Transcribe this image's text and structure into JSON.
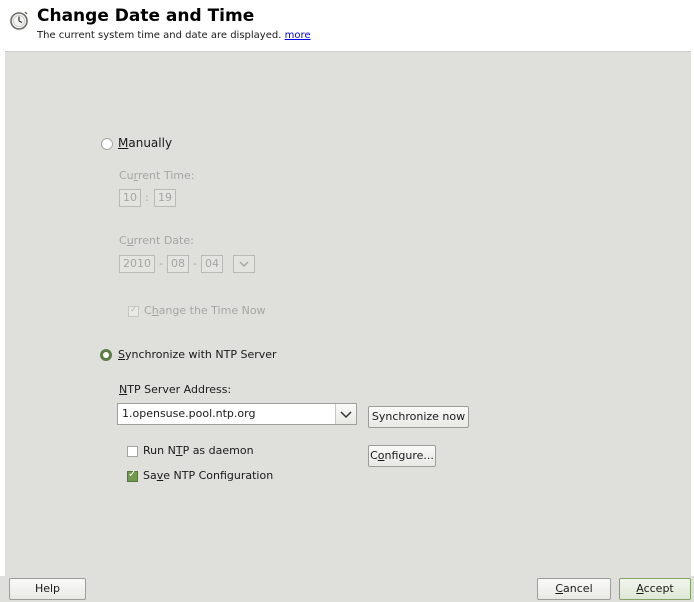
{
  "header": {
    "title": "Change Date and Time",
    "subtitle": "The current system time and date are displayed.",
    "more_link": "more",
    "icon": "clock-icon"
  },
  "manual": {
    "label_prefix": "",
    "label_mnemonic": "M",
    "label_rest": "anually",
    "selected": false,
    "current_time_label": {
      "pre": "Cu",
      "mn": "r",
      "post": "rent Time:"
    },
    "hour": "10",
    "minute": "19",
    "current_date_label": {
      "pre": "C",
      "mn": "u",
      "post": "rrent Date:"
    },
    "year": "2010",
    "month": "08",
    "day": "04",
    "change_now": {
      "pre": "C",
      "mn": "h",
      "post": "ange the Time Now",
      "checked": true,
      "disabled": true
    }
  },
  "ntp": {
    "label_mnemonic": "S",
    "label_rest": "ynchronize with NTP Server",
    "selected": true,
    "address_label": {
      "mn": "N",
      "post": "TP Server Address:"
    },
    "address_value": "1.opensuse.pool.ntp.org",
    "sync_now_button": "Synchronize now",
    "run_daemon": {
      "pre": "Run N",
      "mn": "T",
      "post": "P as daemon",
      "checked": false
    },
    "configure_button": {
      "pre": "C",
      "mn": "o",
      "post": "nfigure..."
    },
    "save_config": {
      "pre": "Sa",
      "mn": "v",
      "post": "e NTP Configuration",
      "checked": true
    }
  },
  "footer": {
    "help_button": "Help",
    "cancel_button": {
      "mn": "C",
      "post": "ancel"
    },
    "accept_button": {
      "mn": "A",
      "post": "ccept"
    }
  },
  "colors": {
    "panel_bg": "#dfe0dc",
    "accent_green": "#6e9a4a",
    "link": "#0000ee"
  }
}
